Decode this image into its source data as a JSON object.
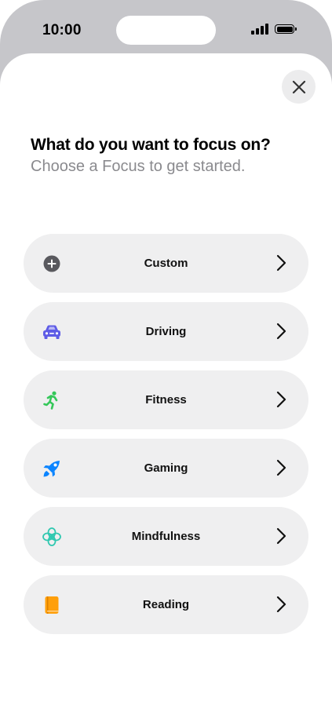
{
  "status_bar": {
    "time": "10:00"
  },
  "sheet": {
    "title": "What do you want to focus on?",
    "subtitle": "Choose a Focus to get started."
  },
  "focus_options": [
    {
      "label": "Custom",
      "icon": "plus-circle-icon",
      "color": "#59595e"
    },
    {
      "label": "Driving",
      "icon": "car-icon",
      "color": "#5e5ce6"
    },
    {
      "label": "Fitness",
      "icon": "running-figure-icon",
      "color": "#34c759"
    },
    {
      "label": "Gaming",
      "icon": "rocket-icon",
      "color": "#0a84ff"
    },
    {
      "label": "Mindfulness",
      "icon": "flower-icon",
      "color": "#30c8b0"
    },
    {
      "label": "Reading",
      "icon": "book-icon",
      "color": "#ff9f0a"
    }
  ]
}
